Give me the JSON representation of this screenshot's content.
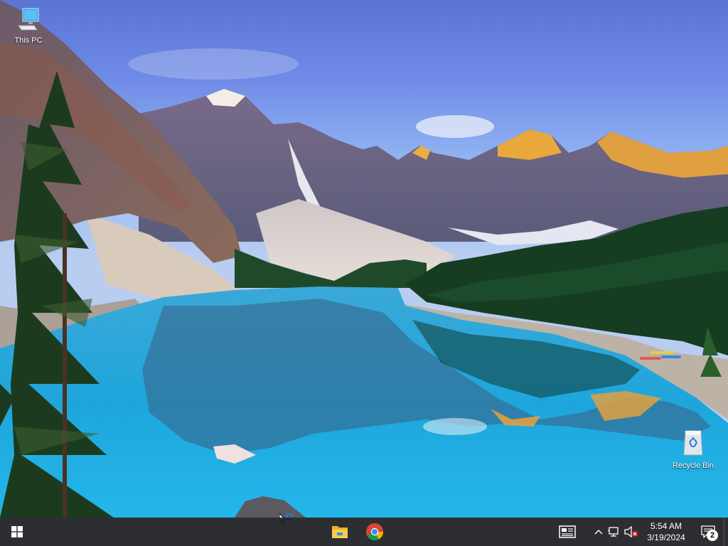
{
  "desktop": {
    "icons": [
      {
        "name": "this-pc",
        "label": "This PC"
      },
      {
        "name": "recycle-bin",
        "label": "Recycle Bin"
      }
    ]
  },
  "taskbar": {
    "pinned": [
      {
        "name": "file-explorer",
        "icon": "folder-icon"
      },
      {
        "name": "google-chrome",
        "icon": "chrome-icon"
      }
    ],
    "tray": {
      "time": "5:54 AM",
      "date": "3/19/2024",
      "notification_count": "2"
    }
  },
  "colors": {
    "taskbar_bg": "#1c1e22",
    "start_accent": "#ffffff",
    "active_indicator": "#8cb4e8"
  }
}
